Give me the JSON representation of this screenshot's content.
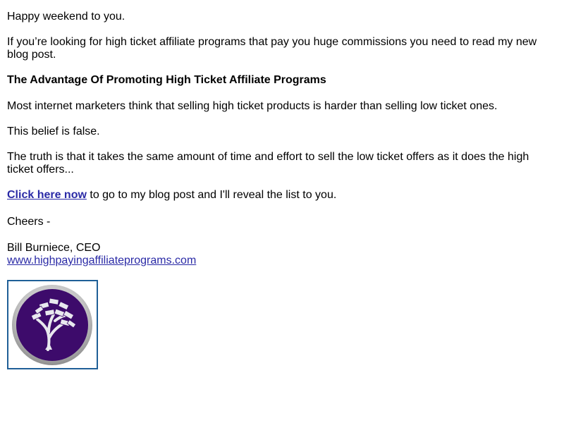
{
  "email": {
    "greeting": "Happy weekend to you.",
    "intro": "If you’re looking for high ticket affiliate programs that pay you huge commissions you need to read my new blog post.",
    "headline": "The Advantage Of Promoting High Ticket Affiliate Programs",
    "paragraph_1": "Most internet marketers think that selling high ticket products is harder than selling low ticket ones.",
    "paragraph_2": "This belief is false.",
    "paragraph_3": "The truth is that it takes the same amount of time and effort to sell the low ticket offers as it does the high ticket offers...",
    "cta_link_text": "Click here now",
    "cta_rest": " to go to my blog post and I'll reveal the list to you.",
    "closing": "Cheers -",
    "signature_name": "Bill Burniece, CEO",
    "website_link_text": "www.highpayingaffiliateprograms.com",
    "logo_icon": "money-tree-logo"
  },
  "colors": {
    "link": "#2a2aa6",
    "logo_border": "#1f5f97",
    "logo_purple": "#3d0b6b",
    "logo_ring": "#c4c4c4"
  }
}
